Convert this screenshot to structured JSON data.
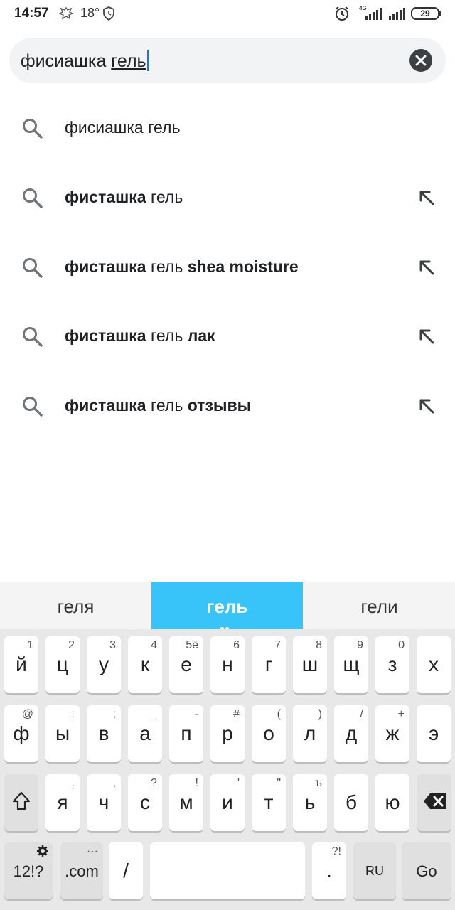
{
  "status_bar": {
    "time": "14:57",
    "temperature": "18°",
    "network": "4G",
    "battery": "29"
  },
  "search": {
    "query_committed": "фисиашка ",
    "query_composing": "гель",
    "clear_icon": "close-icon"
  },
  "suggestions": [
    {
      "parts": [
        {
          "t": "фисиашка гель",
          "b": false
        }
      ],
      "has_arrow": false
    },
    {
      "parts": [
        {
          "t": "фисташка",
          "b": true
        },
        {
          "t": " гель",
          "b": false
        }
      ],
      "has_arrow": true
    },
    {
      "parts": [
        {
          "t": "фисташка",
          "b": true
        },
        {
          "t": " гель ",
          "b": false
        },
        {
          "t": "shea moisture",
          "b": true
        }
      ],
      "has_arrow": true
    },
    {
      "parts": [
        {
          "t": "фисташка",
          "b": true
        },
        {
          "t": " гель ",
          "b": false
        },
        {
          "t": "лак",
          "b": true
        }
      ],
      "has_arrow": true
    },
    {
      "parts": [
        {
          "t": "фисташка",
          "b": true
        },
        {
          "t": " гель ",
          "b": false
        },
        {
          "t": "отзывы",
          "b": true
        }
      ],
      "has_arrow": true
    }
  ],
  "keyboard": {
    "predictions": [
      "геля",
      "гель",
      "гели"
    ],
    "row1": [
      {
        "k": "й",
        "s": "1"
      },
      {
        "k": "ц",
        "s": "2"
      },
      {
        "k": "у",
        "s": "3"
      },
      {
        "k": "к",
        "s": "4"
      },
      {
        "k": "е",
        "s": "5ё"
      },
      {
        "k": "н",
        "s": "6"
      },
      {
        "k": "г",
        "s": "7"
      },
      {
        "k": "ш",
        "s": "8"
      },
      {
        "k": "щ",
        "s": "9"
      },
      {
        "k": "з",
        "s": "0"
      },
      {
        "k": "х",
        "s": ""
      }
    ],
    "row2": [
      {
        "k": "ф",
        "s": "@"
      },
      {
        "k": "ы",
        "s": ":"
      },
      {
        "k": "в",
        "s": ";"
      },
      {
        "k": "а",
        "s": "_"
      },
      {
        "k": "п",
        "s": "-"
      },
      {
        "k": "р",
        "s": "#"
      },
      {
        "k": "о",
        "s": "("
      },
      {
        "k": "л",
        "s": ")"
      },
      {
        "k": "д",
        "s": "/"
      },
      {
        "k": "ж",
        "s": "+"
      },
      {
        "k": "э",
        "s": ""
      }
    ],
    "row3": [
      {
        "k": "я",
        "s": "."
      },
      {
        "k": "ч",
        "s": ","
      },
      {
        "k": "с",
        "s": "?"
      },
      {
        "k": "м",
        "s": "!"
      },
      {
        "k": "и",
        "s": "'"
      },
      {
        "k": "т",
        "s": "\""
      },
      {
        "k": "ь",
        "s": "ъ"
      },
      {
        "k": "б",
        "s": ""
      },
      {
        "k": "ю",
        "s": ""
      }
    ],
    "symbols_label": "12!?",
    "com_label": ".com",
    "com_sub": "···",
    "slash_label": "/",
    "period_label": ".",
    "period_sub": "?!",
    "lang_label": "RU",
    "go_label": "Go"
  }
}
